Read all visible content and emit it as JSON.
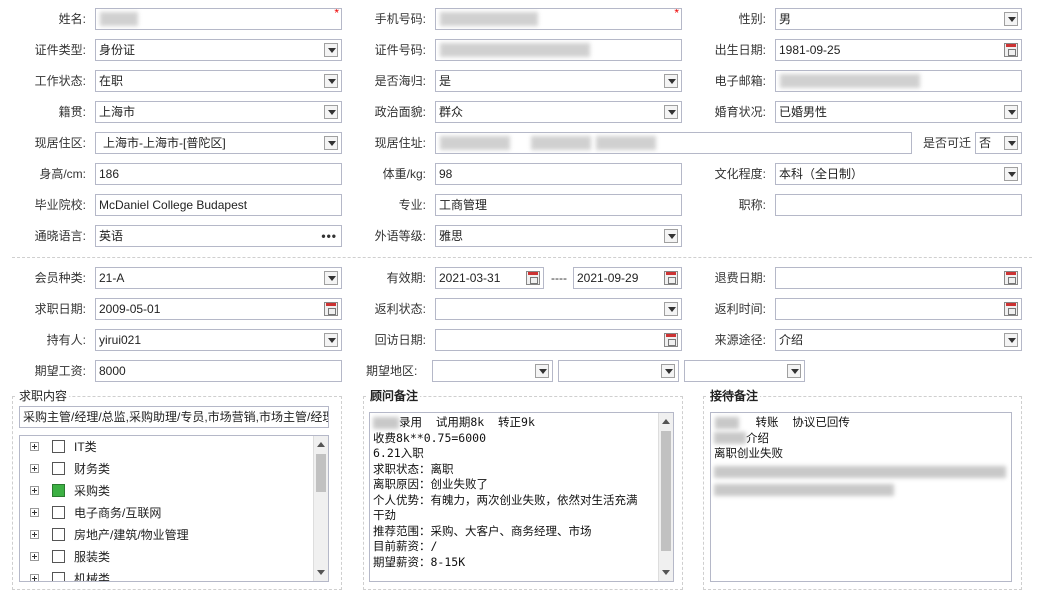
{
  "row1": {
    "name_label": "姓名:",
    "phone_label": "手机号码:",
    "gender_label": "性别:",
    "gender": "男",
    "required_mark": "*"
  },
  "row2": {
    "idtype_label": "证件类型:",
    "idtype": "身份证",
    "idno_label": "证件号码:",
    "birth_label": "出生日期:",
    "birth": "1981-09-25"
  },
  "row3": {
    "work_label": "工作状态:",
    "work": "在职",
    "abroad_label": "是否海归:",
    "abroad": "是",
    "email_label": "电子邮箱:"
  },
  "row4": {
    "native_label": "籍贯:",
    "native": "上海市",
    "politics_label": "政治面貌:",
    "politics": "群众",
    "marital_label": "婚育状况:",
    "marital": "已婚男性"
  },
  "row5": {
    "residence_label": "现居住区:",
    "residence": "上海市-上海市-[普陀区]",
    "address_label": "现居住址:",
    "relocate_label": "是否可迁",
    "relocate": "否"
  },
  "row6": {
    "height_label": "身高/cm:",
    "height": "186",
    "weight_label": "体重/kg:",
    "weight": "98",
    "edu_label": "文化程度:",
    "edu": "本科（全日制）"
  },
  "row7": {
    "school_label": "毕业院校:",
    "school": "McDaniel College Budapest",
    "major_label": "专业:",
    "major": "工商管理",
    "title_label": "职称:",
    "title": ""
  },
  "row8": {
    "lang_label": "通晓语言:",
    "lang": "英语",
    "lang_more": "•••",
    "level_label": "外语等级:",
    "level": "雅思"
  },
  "row9": {
    "member_label": "会员种类:",
    "member": "21-A",
    "valid_label": "有效期:",
    "valid_from": "2021-03-31",
    "valid_sep": "----",
    "valid_to": "2021-09-29",
    "refund_label": "退费日期:"
  },
  "row10": {
    "jobdate_label": "求职日期:",
    "jobdate": "2009-05-01",
    "rebate_label": "返利状态:",
    "rebatetime_label": "返利时间:"
  },
  "row11": {
    "holder_label": "持有人:",
    "holder": "yirui021",
    "visit_label": "回访日期:",
    "source_label": "来源途径:",
    "source": "介绍"
  },
  "row12": {
    "salary_label": "期望工资:",
    "salary": "8000",
    "area_label": "期望地区:"
  },
  "job_panel": {
    "title": "求职内容",
    "summary": "采购主管/经理/总监,采购助理/专员,市场营销,市场主管/经理",
    "items": [
      {
        "label": "IT类",
        "checked": false
      },
      {
        "label": "财务类",
        "checked": false
      },
      {
        "label": "采购类",
        "checked": true
      },
      {
        "label": "电子商务/互联网",
        "checked": false
      },
      {
        "label": "房地产/建筑/物业管理",
        "checked": false
      },
      {
        "label": "服装类",
        "checked": false
      },
      {
        "label": "机械类",
        "checked": false
      }
    ]
  },
  "consultant_panel": {
    "title": "顾问备注",
    "lines": [
      "录用  试用期8k  转正9k",
      "收费8k**0.75=6000",
      "6.21入职",
      "",
      "求职状态：离职",
      "离职原因：创业失败了",
      "个人优势：有魄力，两次创业失败，依然对生活充满",
      "干劲",
      "推荐范围：采购、大客户、商务经理、市场",
      "目前薪资：/",
      "期望薪资：8-15K"
    ]
  },
  "reception_panel": {
    "title": "接待备注",
    "lines": [
      "      转账  协议已回传",
      "",
      "介绍",
      "离职创业失败"
    ]
  }
}
